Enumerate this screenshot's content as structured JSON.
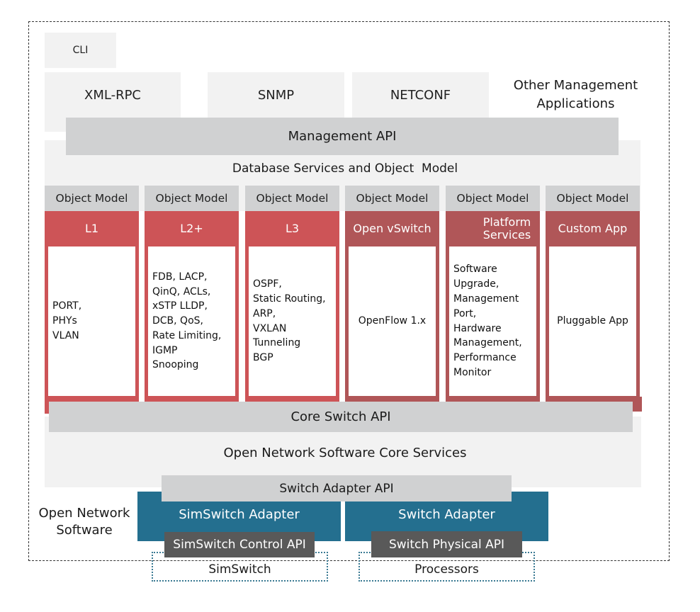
{
  "diagram": {
    "outer_label": "Open Network Software",
    "management": {
      "cli": "CLI",
      "xml_rpc": "XML-RPC",
      "snmp": "SNMP",
      "netconf": "NETCONF",
      "other": "Other Management Applications"
    },
    "management_api": "Management API",
    "database_services": "Database Services and Object  Model",
    "columns": [
      {
        "object_model": "Object Model",
        "title": "L1",
        "content": [
          "PORT,",
          "PHYs",
          "VLAN"
        ],
        "color": "#cd5457"
      },
      {
        "object_model": "Object Model",
        "title": "L2+",
        "content": [
          "FDB, LACP,",
          "QinQ, ACLs,",
          "xSTP LLDP,",
          "DCB, QoS,",
          "Rate Limiting,",
          "IGMP",
          "Snooping"
        ],
        "color": "#cd5457"
      },
      {
        "object_model": "Object Model",
        "title": "L3",
        "content": [
          "OSPF,",
          "Static Routing,",
          "ARP,",
          "VXLAN",
          "Tunneling",
          "BGP"
        ],
        "color": "#cd5457"
      },
      {
        "object_model": "Object Model",
        "title": "Open vSwitch",
        "content": [
          "OpenFlow 1.x"
        ],
        "color": "#b05658"
      },
      {
        "object_model": "Object Model",
        "title": "Platform Services",
        "content": [
          "Software",
          "Upgrade,",
          "Management",
          "Port,",
          "Hardware",
          "Management,",
          "Performance",
          "Monitor"
        ],
        "color": "#b05658"
      },
      {
        "object_model": "Object Model",
        "title": "Custom App",
        "content": [
          "Pluggable App"
        ],
        "color": "#b05658"
      }
    ],
    "core_switch_api": "Core Switch API",
    "core_services": "Open Network Software Core Services",
    "switch_adapter_api": "Switch Adapter API",
    "adapters": {
      "simswitch_adapter": "SimSwitch Adapter",
      "switch_adapter": "Switch Adapter",
      "simswitch_control_api": "SimSwitch Control API",
      "switch_physical_api": "Switch Physical API"
    },
    "external": {
      "simswitch": "SimSwitch",
      "processors": "Processors"
    },
    "colors": {
      "api_gray": "#d0d1d2",
      "layer_light": "#f2f2f2",
      "app_red": "#cd5457",
      "app_rose": "#b05658",
      "adapter_teal": "#246f8f",
      "hw_api_dark": "#595959"
    }
  }
}
